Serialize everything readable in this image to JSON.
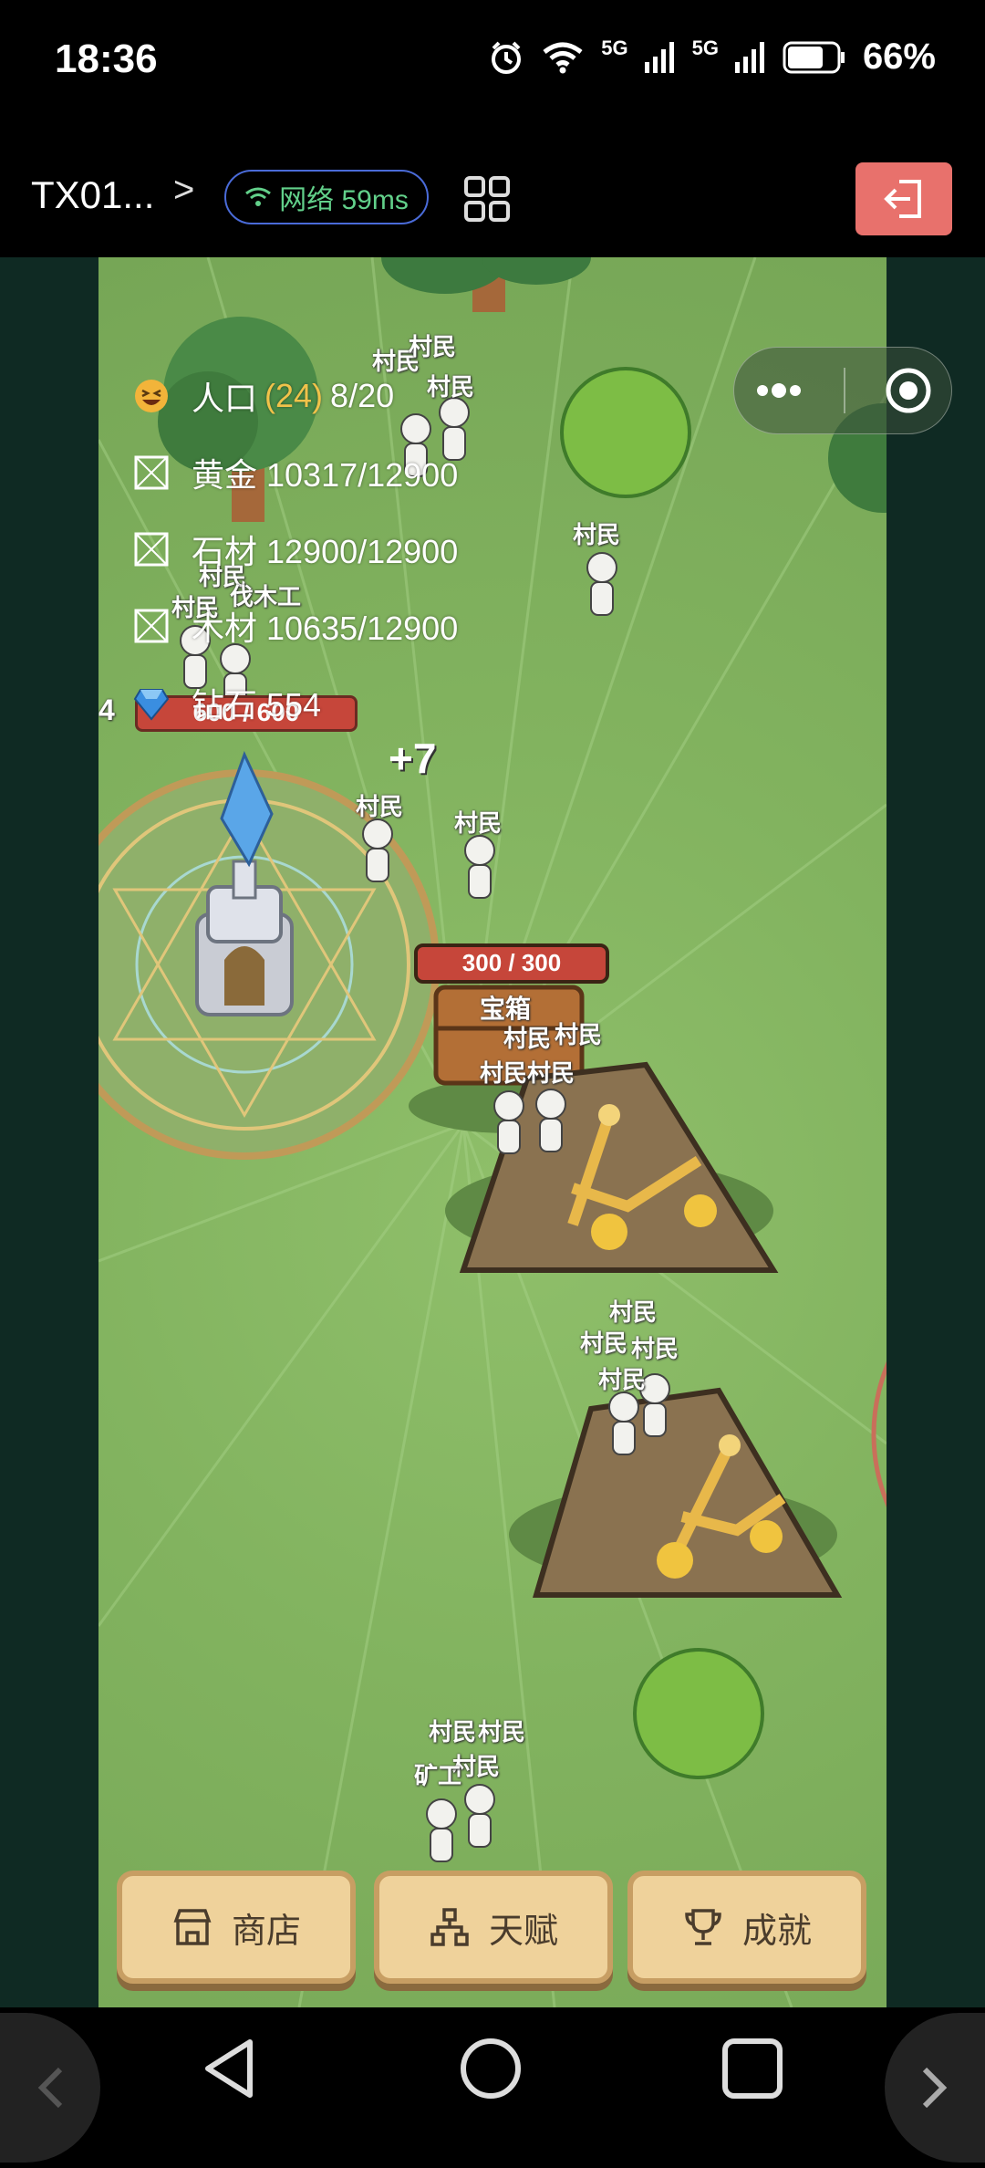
{
  "status_bar": {
    "time": "18:36",
    "signal1": "5G",
    "signal2": "5G",
    "battery": "66%"
  },
  "header": {
    "title": "TX01...",
    "network": "网络 59ms"
  },
  "resources": {
    "population_label": "人口",
    "population_count": "(24)",
    "population_value": "8/20",
    "gold": "黄金 10317/12900",
    "stone": "石材 12900/12900",
    "wood": "木材 10635/12900",
    "gems": "钻石 554"
  },
  "world": {
    "base_hp": "600 / 600",
    "chest_hp": "300 / 300",
    "chest_label": "宝箱",
    "plus_text": "+7",
    "left_edge_number": "4",
    "villager": "村民",
    "lumberjack": "伐木工",
    "miner": "矿工"
  },
  "buttons": {
    "shop": "商店",
    "talent": "天赋",
    "achievement": "成就"
  },
  "icons": {
    "alarm": "alarm-icon",
    "wifi": "wifi-icon",
    "network": "wifi-icon",
    "grid": "grid-icon",
    "exit": "exit-icon",
    "more": "more-icon",
    "record": "record-icon",
    "laugh": "laugh-emoji-icon",
    "gem": "gem-icon",
    "shop": "store-icon",
    "talent": "hierarchy-icon",
    "achievement": "trophy-icon"
  },
  "colors": {
    "grass": "#82b35f",
    "exit_button": "#e8716c",
    "button_bg": "#efd29b",
    "network_text": "#62d08a",
    "hp_bar": "#c6463a"
  }
}
